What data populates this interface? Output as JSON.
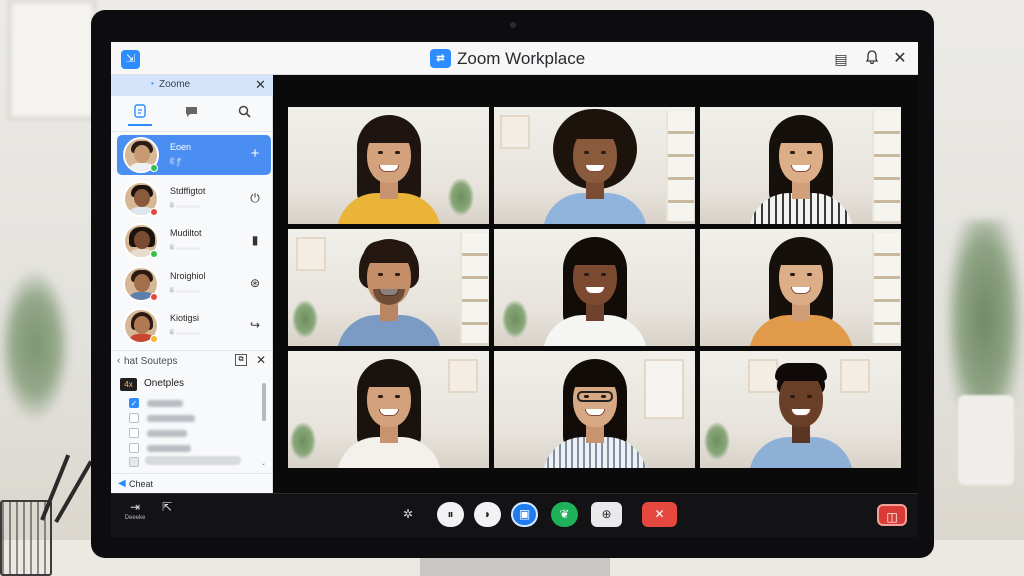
{
  "window": {
    "title": "Zoom Workplace",
    "logo_text": "⇄"
  },
  "titlebar_actions": [
    {
      "icon": "chat-bubble-icon"
    },
    {
      "icon": "bell-icon"
    },
    {
      "icon": "close-icon"
    }
  ],
  "side_panel": {
    "header_title": "Zoome",
    "tabs": [
      {
        "icon": "contacts-icon",
        "active": true
      },
      {
        "icon": "chat-icon",
        "active": false
      },
      {
        "icon": "search-icon",
        "active": false
      }
    ],
    "contacts": [
      {
        "name": "Eoen",
        "sub": "Ɛ ꝭ",
        "status": "green",
        "action": "+",
        "active": true
      },
      {
        "name": "Stdffigtot",
        "sub": "ɕ ………",
        "status": "red",
        "action": "⏻",
        "active": false
      },
      {
        "name": "Mudiltot",
        "sub": "ɕ ………",
        "status": "green",
        "action": "▮",
        "active": false
      },
      {
        "name": "Nroighiol",
        "sub": "ɕ ………",
        "status": "red",
        "action": "⊛",
        "active": false
      },
      {
        "name": "Kiotigsi",
        "sub": "ɕ ………",
        "status": "yellow",
        "action": "↪",
        "active": false
      }
    ],
    "subpanel": {
      "title": "hat Souteps",
      "list_tag": "4x",
      "list_title": "Onetples",
      "items_checked": [
        true,
        false,
        false,
        false,
        false
      ]
    },
    "footer_label": "Cheat"
  },
  "status_colors": {
    "green": "#2fbf4a",
    "red": "#e5483f",
    "yellow": "#f2b52c",
    "accent": "#2d8cff"
  },
  "participants": [
    {
      "id": "p1",
      "speaking": true
    },
    {
      "id": "p2",
      "speaking": false
    },
    {
      "id": "p3",
      "speaking": false
    },
    {
      "id": "p4",
      "speaking": false
    },
    {
      "id": "p5",
      "speaking": false
    },
    {
      "id": "p6",
      "speaking": false
    },
    {
      "id": "p7",
      "speaking": false
    },
    {
      "id": "p8",
      "speaking": false
    },
    {
      "id": "p9",
      "speaking": false
    }
  ],
  "toolbar": {
    "left_buttons": [
      {
        "icon": "exit-icon",
        "label": "Deeeke"
      },
      {
        "icon": "cast-icon",
        "label": ""
      }
    ],
    "controls": [
      {
        "icon": "settings-icon"
      },
      {
        "icon": "mute-icon"
      },
      {
        "icon": "video-icon"
      },
      {
        "icon": "screen-share-icon"
      },
      {
        "icon": "reactions-icon"
      },
      {
        "icon": "more-icon"
      },
      {
        "icon": "end-call-icon"
      },
      {
        "icon": "record-icon"
      }
    ]
  }
}
